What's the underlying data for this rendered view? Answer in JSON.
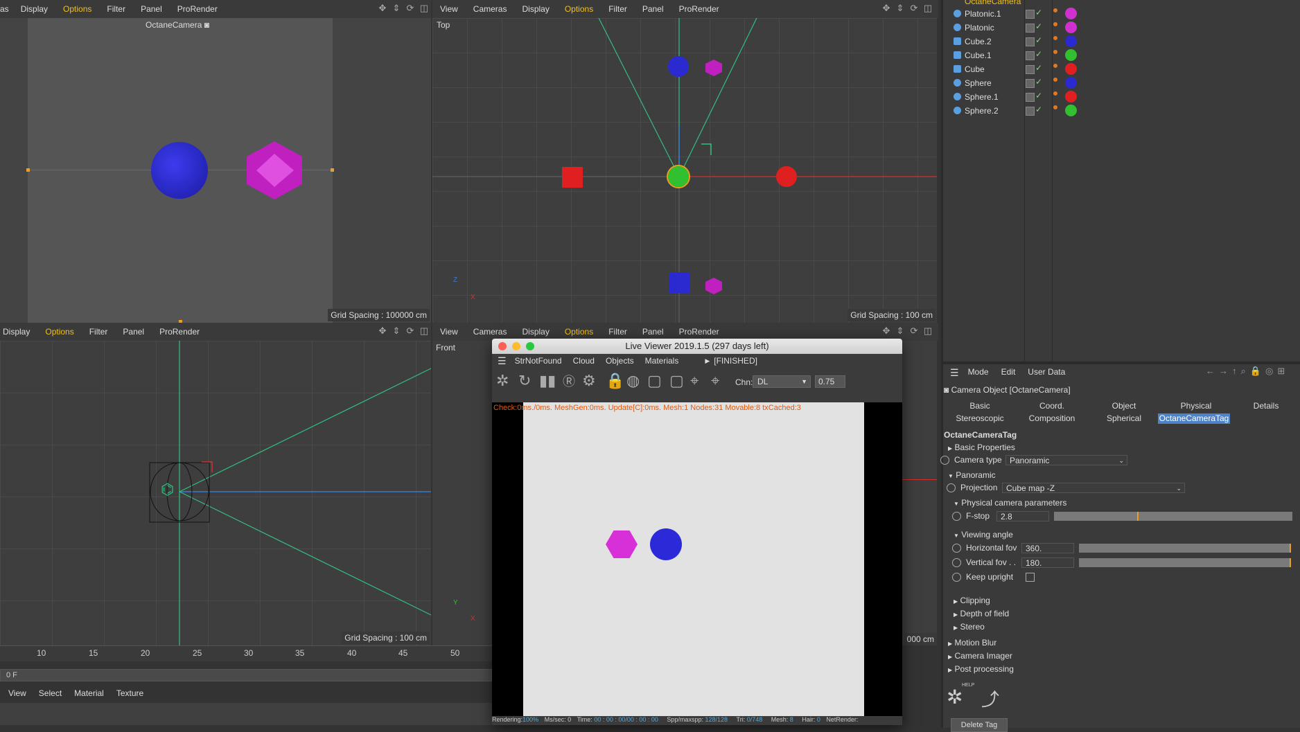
{
  "colors": {
    "accent": "#f0c020",
    "blue": "#2a2ad0",
    "magenta": "#d030d0",
    "green": "#30c030",
    "red": "#e02020",
    "selection": "#4d84c8"
  },
  "vp_tl": {
    "menu": [
      "as",
      "Display",
      "Options",
      "Filter",
      "Panel",
      "ProRender"
    ],
    "camera_label": "OctaneCamera",
    "grid": "Grid Spacing : 100000 cm"
  },
  "vp_tr": {
    "menu": [
      "View",
      "Cameras",
      "Display",
      "Options",
      "Filter",
      "Panel",
      "ProRender"
    ],
    "view_name": "Top",
    "grid": "Grid Spacing : 100 cm",
    "axis_z": "Z",
    "axis_x": "X"
  },
  "vp_bl": {
    "menu": [
      "Display",
      "Options",
      "Filter",
      "Panel",
      "ProRender"
    ],
    "grid": "Grid Spacing : 100 cm"
  },
  "vp_br": {
    "menu": [
      "View",
      "Cameras",
      "Display",
      "Options",
      "Filter",
      "Panel",
      "ProRender"
    ],
    "view_name": "Front",
    "grid_partial": "000 cm",
    "axis_y": "Y",
    "axis_x": "X"
  },
  "timeline": {
    "ticks": [
      "10",
      "15",
      "20",
      "25",
      "30",
      "35",
      "40",
      "45",
      "50"
    ],
    "frame": "0 F"
  },
  "material_bar": [
    "View",
    "Select",
    "Material",
    "Texture"
  ],
  "live_viewer": {
    "title": "Live Viewer 2019.1.5 (297 days left)",
    "menu": [
      "StrNotFound",
      "Cloud",
      "Objects",
      "Materials"
    ],
    "status": "[FINISHED]",
    "channel_label": "Chn:",
    "channel_value": "DL",
    "channel_amount": "0.75",
    "log": "Check:0ms./0ms. MeshGen:0ms. Update[C]:0ms. Mesh:1 Nodes:31 Movable:8 txCached:3",
    "footer": {
      "rendering_label": "Rendering:",
      "rendering_value": "100%",
      "ms_label": "Ms/sec:",
      "ms_value": "0",
      "time_label": "Time:",
      "time_value": "00 : 00 : 00/00 : 00 : 00",
      "spp_label": "Spp/maxspp:",
      "spp_value": "128/128",
      "tri_label": "Tri:",
      "tri_value": "0/748",
      "mesh_label": "Mesh:",
      "mesh_value": "8",
      "hair_label": "Hair:",
      "hair_value": "0",
      "net_label": "NetRender:"
    }
  },
  "object_manager": {
    "top_item": "OctaneCamera",
    "items": [
      {
        "name": "Platonic.1",
        "mat": "#d030d0"
      },
      {
        "name": "Platonic",
        "mat": "#d030d0"
      },
      {
        "name": "Cube.2",
        "mat": "#2a2ad0"
      },
      {
        "name": "Cube.1",
        "mat": "#30c030"
      },
      {
        "name": "Cube",
        "mat": "#e02020"
      },
      {
        "name": "Sphere",
        "mat": "#2a2ad0"
      },
      {
        "name": "Sphere.1",
        "mat": "#e02020"
      },
      {
        "name": "Sphere.2",
        "mat": "#30c030"
      }
    ]
  },
  "attributes": {
    "menu": [
      "Mode",
      "Edit",
      "User Data"
    ],
    "object_title": "Camera Object [OctaneCamera]",
    "tabs_row1": [
      "Basic",
      "Coord.",
      "Object",
      "Physical",
      "Details"
    ],
    "tabs_row2": [
      "Stereoscopic",
      "Composition",
      "Spherical",
      "OctaneCameraTag"
    ],
    "section_title": "OctaneCameraTag",
    "basic_properties": "Basic Properties",
    "camera_type_label": "Camera type",
    "camera_type_value": "Panoramic",
    "panoramic": "Panoramic",
    "projection_label": "Projection",
    "projection_value": "Cube map -Z",
    "physical_params": "Physical camera parameters",
    "fstop_label": "F-stop",
    "fstop_value": "2.8",
    "fstop_level": 0.35,
    "viewing_angle": "Viewing angle",
    "hfov_label": "Horizontal fov",
    "hfov_value": "360.",
    "vfov_label": "Vertical fov . .",
    "vfov_value": "180.",
    "keep_upright_label": "Keep upright",
    "clipping": "Clipping",
    "dof": "Depth of field",
    "stereo": "Stereo",
    "motion_blur": "Motion Blur",
    "camera_imager": "Camera Imager",
    "post_processing": "Post processing",
    "help_label": "HELP",
    "delete_tag": "Delete Tag"
  }
}
